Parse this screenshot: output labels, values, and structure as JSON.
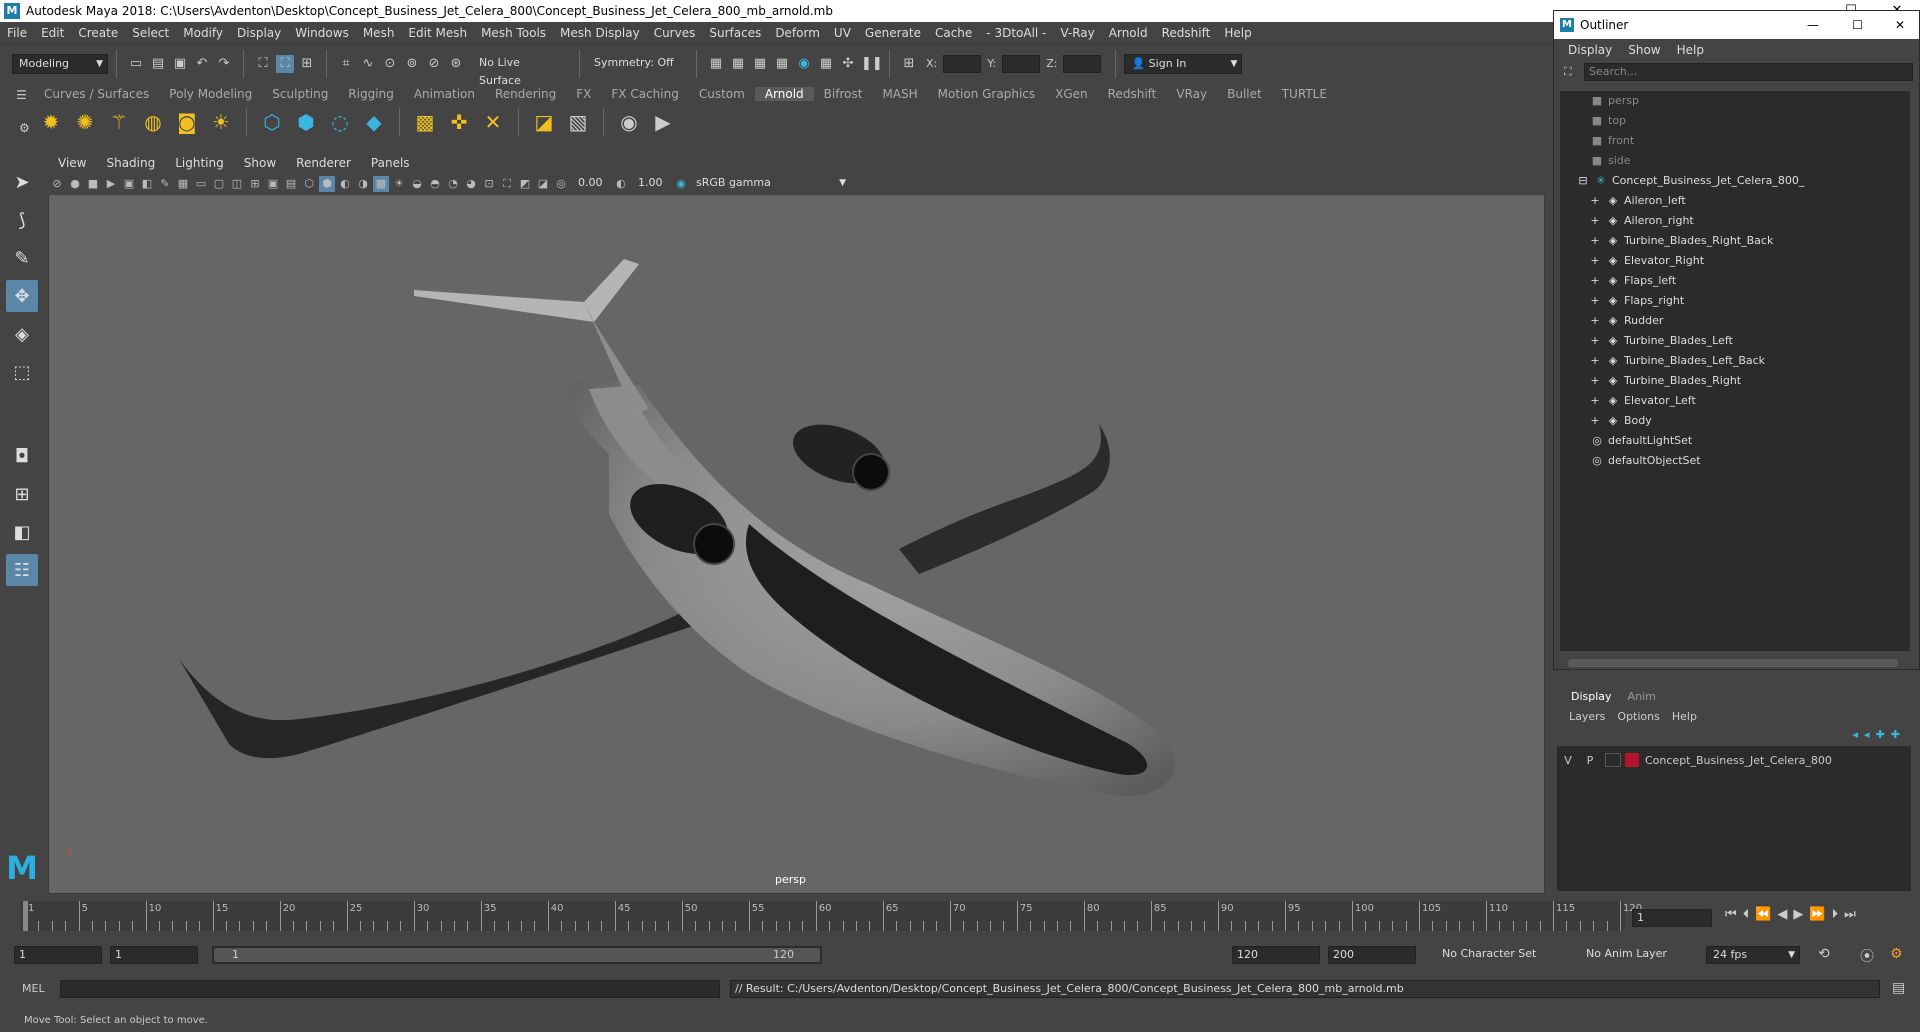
{
  "window": {
    "title": "Autodesk Maya 2018: C:\\Users\\Avdenton\\Desktop\\Concept_Business_Jet_Celera_800\\Concept_Business_Jet_Celera_800_mb_arnold.mb",
    "logo": "M",
    "minimize": "—",
    "maximize": "☐",
    "close": "✕"
  },
  "menubar": [
    "File",
    "Edit",
    "Create",
    "Select",
    "Modify",
    "Display",
    "Windows",
    "Mesh",
    "Edit Mesh",
    "Mesh Tools",
    "Mesh Display",
    "Curves",
    "Surfaces",
    "Deform",
    "UV",
    "Generate",
    "Cache",
    "- 3DtoAll -",
    "V-Ray",
    "Arnold",
    "Redshift",
    "Help"
  ],
  "statusline": {
    "mode": "Modeling",
    "live_surface": "No Live Surface",
    "symmetry": "Symmetry: Off",
    "x_label": "X:",
    "y_label": "Y:",
    "z_label": "Z:",
    "sign_in": "Sign In"
  },
  "shelf": {
    "tabs": [
      "Curves / Surfaces",
      "Poly Modeling",
      "Sculpting",
      "Rigging",
      "Animation",
      "Rendering",
      "FX",
      "FX Caching",
      "Custom",
      "Arnold",
      "Bifrost",
      "MASH",
      "Motion Graphics",
      "XGen",
      "Redshift",
      "VRay",
      "Bullet",
      "TURTLE"
    ],
    "active_tab": "Arnold"
  },
  "panel": {
    "menu": [
      "View",
      "Shading",
      "Lighting",
      "Show",
      "Renderer",
      "Panels"
    ],
    "exposure": "0.00",
    "gamma": "1.00",
    "color_space": "sRGB gamma",
    "camera_label": "persp"
  },
  "outliner": {
    "title": "Outliner",
    "menu": [
      "Display",
      "Show",
      "Help"
    ],
    "search_placeholder": "Search...",
    "cameras": [
      "persp",
      "top",
      "front",
      "side"
    ],
    "root": "Concept_Business_Jet_Celera_800_",
    "children": [
      "Aileron_left",
      "Aileron_right",
      "Turbine_Blades_Right_Back",
      "Elevator_Right",
      "Flaps_left",
      "Flaps_right",
      "Rudder",
      "Turbine_Blades_Left",
      "Turbine_Blades_Left_Back",
      "Turbine_Blades_Right",
      "Elevator_Left",
      "Body"
    ],
    "sets": [
      "defaultLightSet",
      "defaultObjectSet"
    ]
  },
  "layers": {
    "tabs": [
      "Display",
      "Anim"
    ],
    "active_tab": "Display",
    "menu": [
      "Layers",
      "Options",
      "Help"
    ],
    "row": {
      "v": "V",
      "p": "P",
      "name": "Concept_Business_Jet_Celera_800",
      "color": "#b5122b"
    }
  },
  "timeline": {
    "ticks": [
      1,
      5,
      10,
      15,
      20,
      25,
      30,
      35,
      40,
      45,
      50,
      55,
      60,
      65,
      70,
      75,
      80,
      85,
      90,
      95,
      100,
      105,
      110,
      115,
      120
    ],
    "current_frame": "1",
    "min": 1,
    "max": 120
  },
  "range": {
    "start": "1",
    "anim_start": "1",
    "slider_start": "1",
    "slider_end": "120",
    "anim_end": "120",
    "end": "200",
    "character_set": "No Character Set",
    "anim_layer": "No Anim Layer",
    "fps": "24 fps"
  },
  "command": {
    "lang": "MEL",
    "result": "// Result: C:/Users/Avdenton/Desktop/Concept_Business_Jet_Celera_800/Concept_Business_Jet_Celera_800_mb_arnold.mb"
  },
  "helpline": "Move Tool: Select an object to move."
}
